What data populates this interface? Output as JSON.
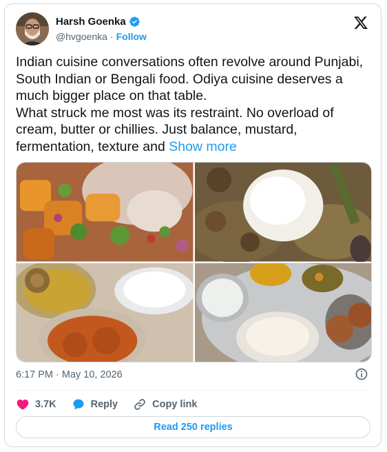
{
  "author": {
    "name": "Harsh Goenka",
    "handle": "@hvgoenka",
    "separator": "·",
    "follow_label": "Follow",
    "verified_color": "#1d9bf0"
  },
  "tweet": {
    "paragraph_1": "Indian cuisine conversations often revolve around Punjabi, South Indian or Bengali food. Odiya cuisine deserves a much bigger place on that table.",
    "paragraph_2": "What struck me most was its restraint. No overload of cream, butter or chillies. Just balance, mustard, fermentation, texture and",
    "show_more": "Show more"
  },
  "media": {
    "photo_count": 4,
    "photos": [
      "potato curry with onions and coriander",
      "rice with curry and drumsticks",
      "thali with dal, rice and curry",
      "steel thali with pitha, curd and sides"
    ]
  },
  "meta": {
    "timestamp": "6:17 PM · May 10, 2026"
  },
  "actions": {
    "like_count": "3.7K",
    "reply_label": "Reply",
    "copy_link_label": "Copy link"
  },
  "footer": {
    "read_replies_label": "Read 250 replies"
  },
  "colors": {
    "accent": "#1d9bf0",
    "like": "#f91880",
    "text": "#0f1419",
    "muted": "#536471",
    "border": "#cfd9de"
  }
}
